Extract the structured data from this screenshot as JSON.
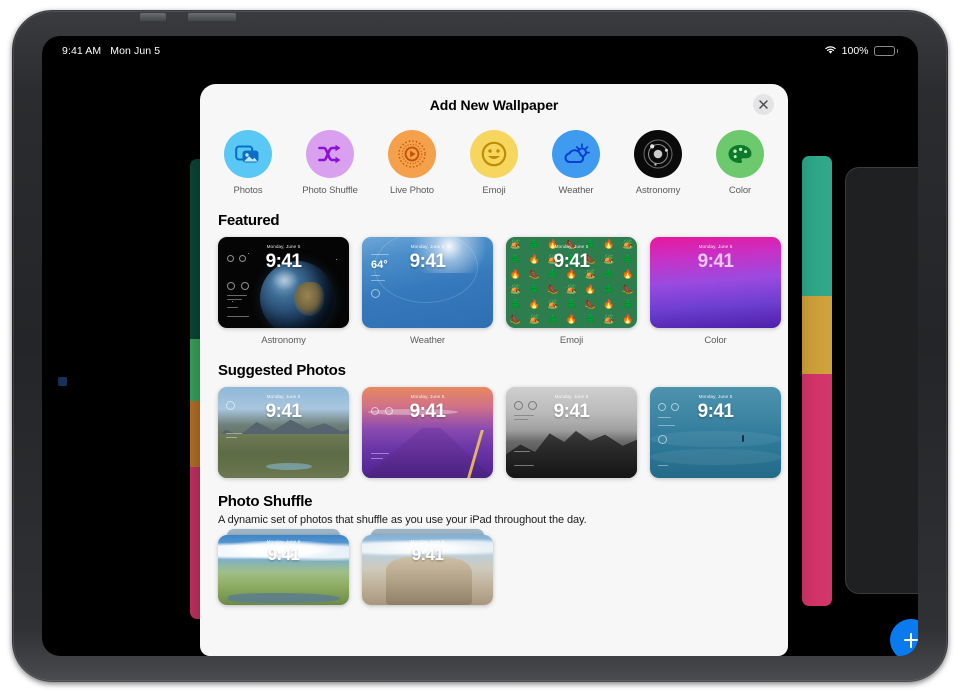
{
  "status_bar": {
    "time": "9:41 AM",
    "date": "Mon Jun 5",
    "wifi_icon": "wifi-icon",
    "battery_percent": "100%",
    "battery_icon": "battery-full-icon"
  },
  "modal": {
    "title": "Add New Wallpaper",
    "close_icon": "close-icon"
  },
  "categories": [
    {
      "label": "Photos",
      "icon": "photos-icon",
      "circle_color": "#5ac8f5",
      "glyph_color": "#0a84d8"
    },
    {
      "label": "Photo Shuffle",
      "icon": "shuffle-icon",
      "circle_color": "#d9a0f0",
      "glyph_color": "#8e0fd0"
    },
    {
      "label": "Live Photo",
      "icon": "live-photo-icon",
      "circle_color": "#f5a04a",
      "glyph_color": "#c4520a"
    },
    {
      "label": "Emoji",
      "icon": "emoji-smiley-icon",
      "circle_color": "#f6d65e",
      "glyph_color": "#c08c00"
    },
    {
      "label": "Weather",
      "icon": "weather-sun-cloud-icon",
      "circle_color": "#3e9bf0",
      "glyph_color": "#0a3fd0"
    },
    {
      "label": "Astronomy",
      "icon": "astronomy-orbit-icon",
      "circle_color": "#0a0a0a",
      "glyph_color": "#d8d8d8"
    },
    {
      "label": "Color",
      "icon": "color-palette-icon",
      "circle_color": "#6dc96d",
      "glyph_color": "#0c7a28"
    }
  ],
  "featured": {
    "title": "Featured",
    "items": [
      {
        "label": "Astronomy",
        "time": "9:41",
        "date": "Monday, June 5"
      },
      {
        "label": "Weather",
        "time": "9:41",
        "date": "Monday, June 5",
        "temperature": "64°"
      },
      {
        "label": "Emoji",
        "time": "9:41",
        "date": "Monday, June 5"
      },
      {
        "label": "Color",
        "time": "9:41",
        "date": "Monday, June 5"
      }
    ]
  },
  "suggested_photos": {
    "title": "Suggested Photos",
    "items": [
      {
        "time": "9:41",
        "date": "Monday, June 5"
      },
      {
        "time": "9:41",
        "date": "Monday, June 5"
      },
      {
        "time": "9:41",
        "date": "Monday, June 5"
      },
      {
        "time": "9:41",
        "date": "Monday, June 5"
      }
    ]
  },
  "photo_shuffle": {
    "title": "Photo Shuffle",
    "description": "A dynamic set of photos that shuffle as you use your iPad throughout the day.",
    "items": [
      {
        "time": "9:41",
        "date": "Monday, June 5"
      },
      {
        "time": "9:41",
        "date": "Monday, June 5"
      }
    ]
  },
  "background": {
    "add_button_icon": "plus-icon",
    "strip_left_colors": [
      "#0d4a3a",
      "#3fae62",
      "#c27a2c",
      "#d4356b"
    ],
    "strip_right_colors": [
      "#2fa98a",
      "#d0a23a",
      "#d4356b",
      "#cf5f8e"
    ]
  }
}
